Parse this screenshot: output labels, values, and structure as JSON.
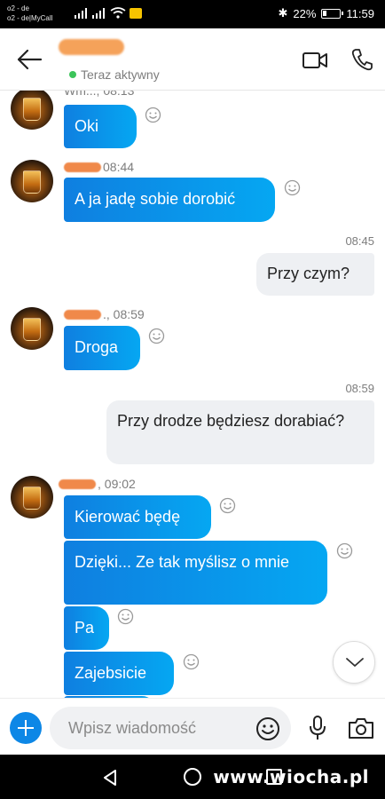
{
  "status_bar": {
    "carrier_line1": "o2 - de",
    "carrier_line2": "o2 - de|MyCall",
    "battery": "22%",
    "time": "11:59"
  },
  "header": {
    "presence": "Teraz aktywny",
    "presence_color": "#3cc45a"
  },
  "messages": {
    "m1": {
      "sender_suffix": "Wm..., 08:13",
      "text": "Oki"
    },
    "m2": {
      "time": "08:44",
      "text": "A ja jadę sobie dorobić"
    },
    "m3": {
      "time": "08:45",
      "text": "Przy czym?"
    },
    "m4": {
      "time": "., 08:59",
      "text": "Droga"
    },
    "m5": {
      "time": "08:59",
      "text": "Przy drodze będziesz dorabiać?"
    },
    "m6": {
      "time": ", 09:02",
      "text": "Kierować będę"
    },
    "m7": {
      "text": "Dzięki... Ze tak myślisz o mnie"
    },
    "m8": {
      "text": "Pa"
    },
    "m9": {
      "text": "Zajebsicie"
    }
  },
  "composer": {
    "placeholder": "Wpisz wiadomość"
  },
  "watermark": "www.wiocha.pl",
  "colors": {
    "incoming_bubble": "#0f7fe0",
    "outgoing_bubble": "#eef0f3",
    "accent": "#0d87e6"
  },
  "icons": [
    "back-arrow-icon",
    "video-camera-icon",
    "phone-icon",
    "smiley-icon",
    "chevron-down-icon",
    "plus-icon",
    "emoji-icon",
    "microphone-icon",
    "camera-icon"
  ]
}
